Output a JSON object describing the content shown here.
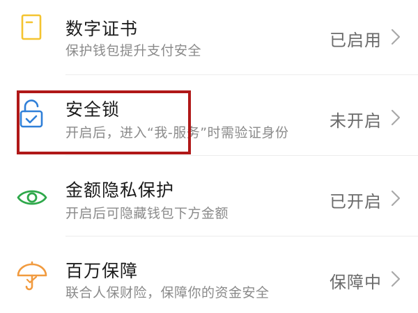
{
  "items": [
    {
      "title": "数字证书",
      "subtitle": "保护钱包提升支付安全",
      "status": "已启用",
      "icon": "certificate-icon",
      "icon_color": "#f4c430"
    },
    {
      "title": "安全锁",
      "subtitle": "开启后，进入“我-服务”时需验证身份",
      "status": "未开启",
      "icon": "lock-icon",
      "icon_color": "#2f7fd8"
    },
    {
      "title": "金额隐私保护",
      "subtitle": "开启后可隐藏钱包下方金额",
      "status": "已开启",
      "icon": "eye-icon",
      "icon_color": "#2ea84a"
    },
    {
      "title": "百万保障",
      "subtitle": "联合人保财险，保障你的资金安全",
      "status": "保障中",
      "icon": "umbrella-icon",
      "icon_color": "#f19a3e"
    }
  ],
  "highlight_color": "#b01818"
}
